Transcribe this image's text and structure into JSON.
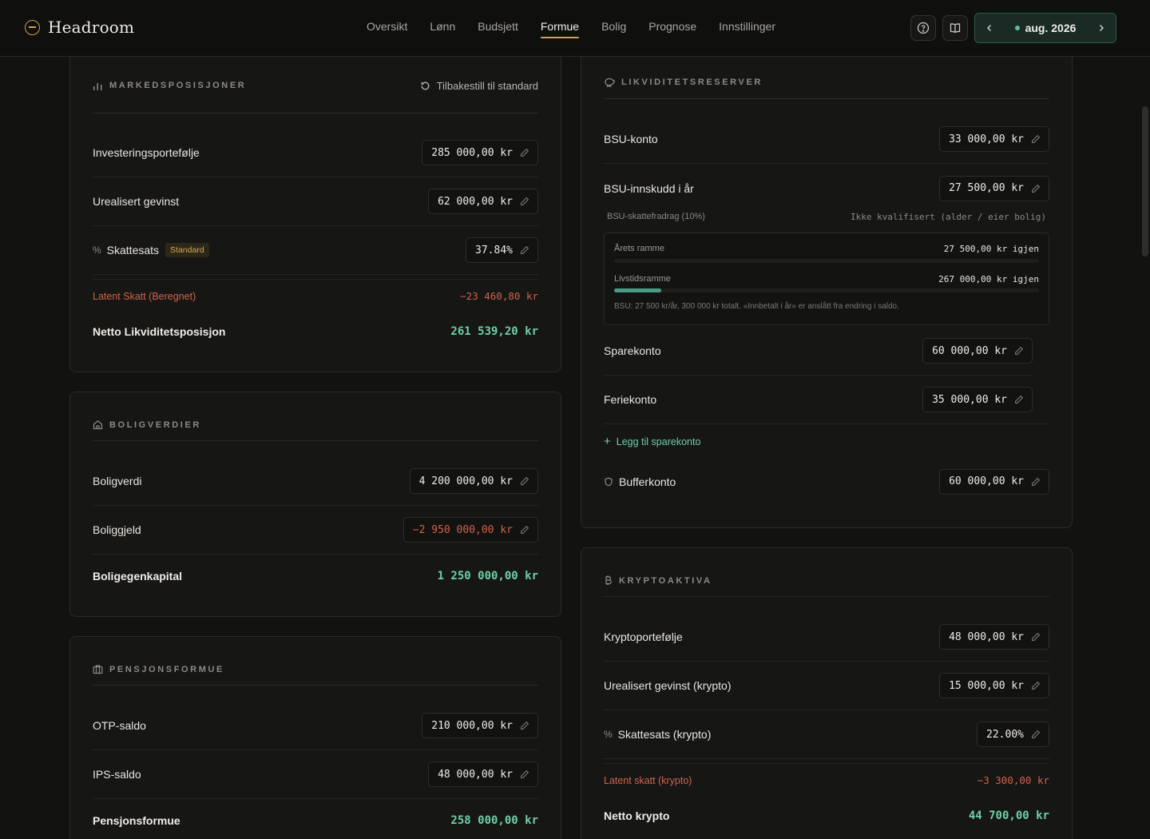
{
  "app": {
    "name": "Headroom"
  },
  "nav": {
    "items": [
      "Oversikt",
      "Lønn",
      "Budsjett",
      "Formue",
      "Bolig",
      "Prognose",
      "Innstillinger"
    ],
    "active": "Formue"
  },
  "header": {
    "month": "aug. 2026",
    "help_icon": "help-circle-icon",
    "book_icon": "book-icon"
  },
  "markeds": {
    "title": "MARKEDSPOSISJONER",
    "reset_label": "Tilbakestill til standard",
    "rows": [
      {
        "label": "Investeringsportefølje",
        "value": "285 000,00 kr"
      },
      {
        "label": "Urealisert gevinst",
        "value": "62 000,00 kr"
      },
      {
        "label": "Skattesats",
        "badge": "Standard",
        "value": "37.84%"
      }
    ],
    "latent_label": "Latent Skatt (Beregnet)",
    "latent_value": "−23 460,80 kr",
    "net_label": "Netto Likviditetsposisjon",
    "net_value": "261 539,20 kr"
  },
  "bolig": {
    "title": "BOLIGVERDIER",
    "rows": [
      {
        "label": "Boligverdi",
        "value": "4 200 000,00 kr"
      },
      {
        "label": "Boliggjeld",
        "value": "−2 950 000,00 kr"
      }
    ],
    "equity_label": "Boligegenkapital",
    "equity_value": "1 250 000,00 kr"
  },
  "pensjon": {
    "title": "PENSJONSFORMUE",
    "rows": [
      {
        "label": "OTP-saldo",
        "value": "210 000,00 kr"
      },
      {
        "label": "IPS-saldo",
        "value": "48 000,00 kr"
      }
    ],
    "total_label": "Pensjonsformue",
    "total_value": "258 000,00 kr"
  },
  "likvid": {
    "title": "LIKVIDITETSRESERVER",
    "rows": [
      {
        "label": "BSU-konto",
        "value": "33 000,00 kr"
      },
      {
        "label": "BSU-innskudd i år",
        "value": "27 500,00 kr"
      },
      {
        "label": "Sparekonto",
        "value": "60 000,00 kr"
      },
      {
        "label": "Feriekonto",
        "value": "35 000,00 kr"
      }
    ],
    "bsu_deduction_label": "BSU-skattefradrag (10%)",
    "bsu_deduction_status": "Ikke kvalifisert (alder / eier bolig)",
    "annual_label": "Årets ramme",
    "annual_value": "27 500,00 kr igjen",
    "annual_progress": 0.0,
    "lifetime_label": "Livstidsramme",
    "lifetime_value": "267 000,00 kr igjen",
    "lifetime_progress": 0.11,
    "bsu_note": "BSU: 27 500 kr/år, 300 000 kr totalt. «Innbetalt i år» er anslått fra endring i saldo.",
    "add_label": "Legg til sparekonto",
    "buffer_label": "Bufferkonto",
    "buffer_value": "60 000,00 kr"
  },
  "krypto": {
    "title": "KRYPTOAKTIVA",
    "rows": [
      {
        "label": "Kryptoportefølje",
        "value": "48 000,00 kr"
      },
      {
        "label": "Urealisert gevinst (krypto)",
        "value": "15 000,00 kr"
      },
      {
        "label": "Skattesats (krypto)",
        "value": "22.00%"
      }
    ],
    "latent_label": "Latent skatt (krypto)",
    "latent_value": "−3 300,00 kr",
    "net_label": "Netto krypto",
    "net_value": "44 700,00 kr"
  },
  "colors": {
    "accent": "#c9a24a",
    "positive": "#6fcfa5",
    "negative": "#d2634a"
  }
}
